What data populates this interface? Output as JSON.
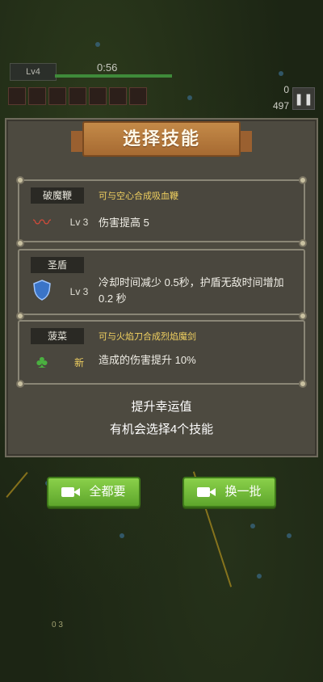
{
  "hud": {
    "level": "Lv4",
    "timer": "0:56",
    "score": "0",
    "kills": "497",
    "pause_icon": "pause-icon"
  },
  "dialog": {
    "title": "选择技能",
    "skills": [
      {
        "name": "破魔鞭",
        "combo": "可与空心合成吸血鞭",
        "level": "Lv 3",
        "desc": "伤害提高 5",
        "icon": "whip-icon"
      },
      {
        "name": "圣盾",
        "combo": "",
        "level": "Lv 3",
        "desc": "冷却时间减少 0.5秒，护盾无敌时间增加 0.2 秒",
        "icon": "shield-icon"
      },
      {
        "name": "菠菜",
        "combo": "可与火焰刀合成烈焰魔剑",
        "level": "新",
        "desc": "造成的伤害提升 10%",
        "icon": "spinach-icon"
      }
    ],
    "luck_line1": "提升幸运值",
    "luck_line2": "有机会选择4个技能"
  },
  "buttons": {
    "take_all": "全都要",
    "refresh": "换一批"
  },
  "colors": {
    "button_green": "#6fbc36",
    "combo_yellow": "#f0d060",
    "banner_orange": "#b87a3c"
  },
  "footer_text": "0 3"
}
